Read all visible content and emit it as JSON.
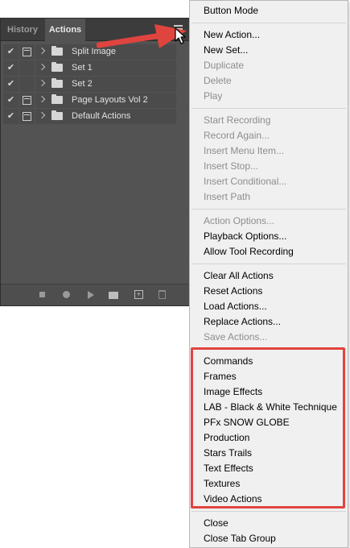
{
  "panel": {
    "tabs": [
      {
        "label": "History"
      },
      {
        "label": "Actions"
      }
    ],
    "actions": [
      {
        "checked": "✔",
        "name": "Split Image"
      },
      {
        "checked": "✔",
        "name": "Set 1"
      },
      {
        "checked": "✔",
        "name": "Set 2"
      },
      {
        "checked": "✔",
        "name": "Page Layouts Vol 2"
      },
      {
        "checked": "✔",
        "name": "Default Actions"
      }
    ],
    "panel_menu_icon": "hamburger-icon",
    "bottom_icons": [
      "stop-icon",
      "record-icon",
      "play-icon",
      "new-set-icon",
      "new-action-icon",
      "delete-icon"
    ]
  },
  "annotation": {
    "arrow_color": "#e0443f",
    "highlight_color": "#e0443f"
  },
  "menu": {
    "groups": [
      [
        {
          "label": "Button Mode",
          "enabled": true
        }
      ],
      [
        {
          "label": "New Action...",
          "enabled": true
        },
        {
          "label": "New Set...",
          "enabled": true
        },
        {
          "label": "Duplicate",
          "enabled": false
        },
        {
          "label": "Delete",
          "enabled": false
        },
        {
          "label": "Play",
          "enabled": false
        }
      ],
      [
        {
          "label": "Start Recording",
          "enabled": false
        },
        {
          "label": "Record Again...",
          "enabled": false
        },
        {
          "label": "Insert Menu Item...",
          "enabled": false
        },
        {
          "label": "Insert Stop...",
          "enabled": false
        },
        {
          "label": "Insert Conditional...",
          "enabled": false
        },
        {
          "label": "Insert Path",
          "enabled": false
        }
      ],
      [
        {
          "label": "Action Options...",
          "enabled": false
        },
        {
          "label": "Playback Options...",
          "enabled": true
        },
        {
          "label": "Allow Tool Recording",
          "enabled": true
        }
      ],
      [
        {
          "label": "Clear All Actions",
          "enabled": true
        },
        {
          "label": "Reset Actions",
          "enabled": true
        },
        {
          "label": "Load Actions...",
          "enabled": true
        },
        {
          "label": "Replace Actions...",
          "enabled": true
        },
        {
          "label": "Save Actions...",
          "enabled": false
        }
      ],
      [
        {
          "label": "Commands",
          "enabled": true
        },
        {
          "label": "Frames",
          "enabled": true
        },
        {
          "label": "Image Effects",
          "enabled": true
        },
        {
          "label": "LAB - Black & White Technique",
          "enabled": true
        },
        {
          "label": "PFx SNOW GLOBE",
          "enabled": true
        },
        {
          "label": "Production",
          "enabled": true
        },
        {
          "label": "Stars Trails",
          "enabled": true
        },
        {
          "label": "Text Effects",
          "enabled": true
        },
        {
          "label": "Textures",
          "enabled": true
        },
        {
          "label": "Video Actions",
          "enabled": true
        }
      ],
      [
        {
          "label": "Close",
          "enabled": true
        },
        {
          "label": "Close Tab Group",
          "enabled": true
        }
      ]
    ]
  }
}
